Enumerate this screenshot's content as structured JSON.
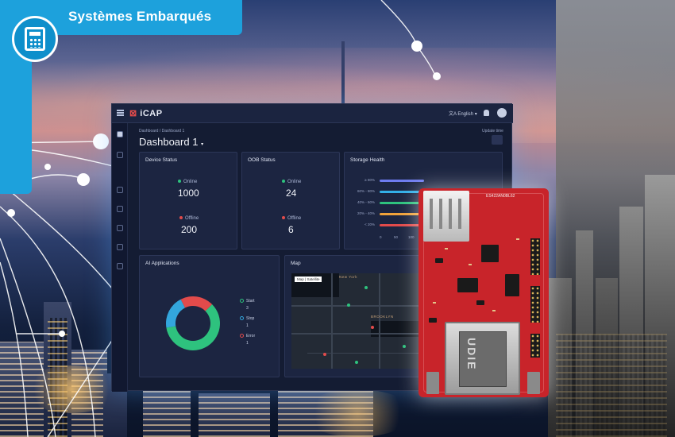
{
  "badge": {
    "title": "Systèmes Embarqués",
    "icon": "calculator-icon"
  },
  "dashboard": {
    "app_name": "iCAP",
    "language": "English",
    "breadcrumb": "Dashboard / Dashboard 1",
    "title": "Dashboard 1",
    "update_label": "Update time",
    "device_status": {
      "title": "Device Status",
      "online_label": "Online",
      "online_value": "1000",
      "offline_label": "Offline",
      "offline_value": "200"
    },
    "oob_status": {
      "title": "OOB Status",
      "online_label": "Online",
      "online_value": "24",
      "offline_label": "Offline",
      "offline_value": "6"
    },
    "storage_health": {
      "title": "Storage Health",
      "rows": [
        {
          "label": "≥ 80%",
          "color": "#6e7cf0"
        },
        {
          "label": "60% - 80%",
          "color": "#33b0e8"
        },
        {
          "label": "40% - 60%",
          "color": "#2ec27e"
        },
        {
          "label": "20% - 40%",
          "color": "#f0a23a"
        },
        {
          "label": "< 20%",
          "color": "#e24b4b"
        }
      ],
      "axis": [
        "0",
        "50",
        "100"
      ]
    },
    "ai_applications": {
      "title": "AI Applications",
      "legend": [
        {
          "label": "Start",
          "value": "3",
          "color": "#2ec27e"
        },
        {
          "label": "Stop",
          "value": "1",
          "color": "#33a6dc"
        },
        {
          "label": "Error",
          "value": "1",
          "color": "#e24b4b"
        }
      ]
    },
    "map": {
      "title": "Map",
      "tab_map": "Map",
      "tab_sat": "Satellite",
      "label_city": "New York",
      "label_area": "BROOKLYN"
    }
  },
  "board": {
    "silk_top": "ES422AN0BL62",
    "port_text": "UDIE"
  },
  "chart_data": [
    {
      "type": "pie",
      "title": "AI Applications",
      "categories": [
        "Start",
        "Stop",
        "Error"
      ],
      "values": [
        3,
        1,
        1
      ]
    }
  ]
}
